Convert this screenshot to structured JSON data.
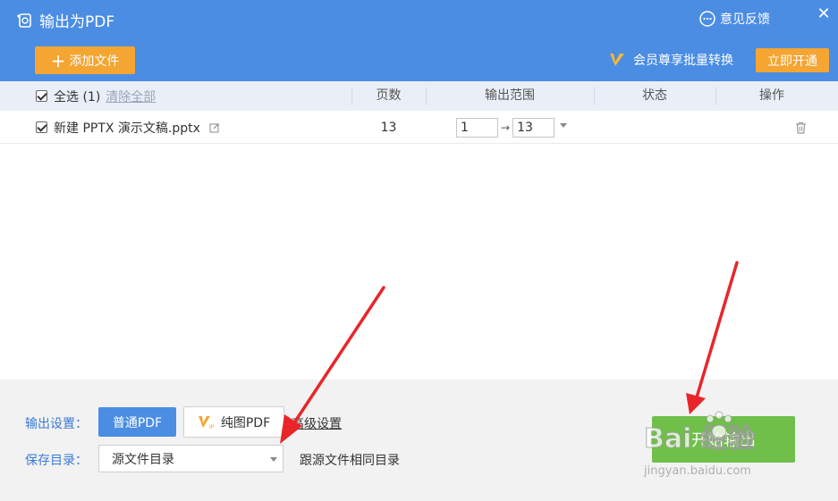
{
  "window": {
    "title": "输出为PDF",
    "feedback_label": "意见反馈",
    "close_glyph": "✕"
  },
  "toolbar": {
    "add_label": "添加文件",
    "add_plus": "+",
    "vip_note": "会员尊享批量转换",
    "open_label": "立即开通"
  },
  "table": {
    "select_all_label": "全选 (1)",
    "clear_label": "清除全部",
    "columns": [
      "页数",
      "输出范围",
      "状态",
      "操作"
    ],
    "rows": [
      {
        "checked": true,
        "name": "新建 PPTX 演示文稿.pptx",
        "pages": "13",
        "range_from": "1",
        "range_arrow": "→",
        "range_to": "13",
        "status": ""
      }
    ]
  },
  "settings": {
    "output_label": "输出设置：",
    "normal_pdf_label": "普通PDF",
    "pure_pdf_label": "纯图PDF",
    "advanced_label": "高级设置",
    "save_label": "保存目录：",
    "save_dir_value": "源文件目录",
    "save_dir_note": "跟源文件相同目录",
    "start_label": "开始输出"
  },
  "colors": {
    "header_bg": "#4b8de3",
    "accent_orange": "#f4a532",
    "start_green": "#6fbf4a",
    "link_blue": "#3b7bd6",
    "arrow_red": "#e8262a"
  },
  "watermark": {
    "brand": "Bai 经验",
    "url": "jingyan.baidu.com"
  }
}
